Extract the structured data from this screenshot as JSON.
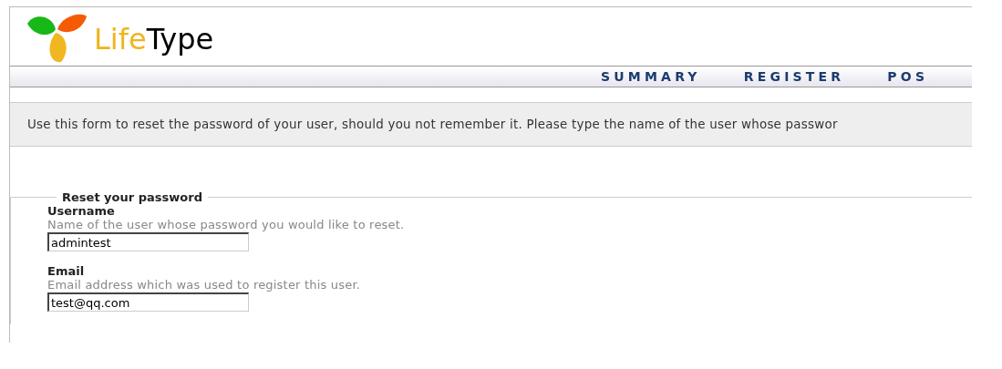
{
  "logo": {
    "text": [
      "Life",
      "Type"
    ]
  },
  "nav": [
    {
      "label": "SUMMARY"
    },
    {
      "label": "REGISTER"
    },
    {
      "label": "POS"
    }
  ],
  "info": "Use this form to reset the password of your user, should you not remember it. Please type the name of the user whose passwor",
  "form": {
    "legend": "Reset your password",
    "fields": [
      {
        "label": "Username",
        "help": "Name of the user whose password you would like to reset.",
        "value": "admintest"
      },
      {
        "label": "Email",
        "help": "Email address which was used to register this user.",
        "value": "test@qq.com"
      }
    ]
  }
}
